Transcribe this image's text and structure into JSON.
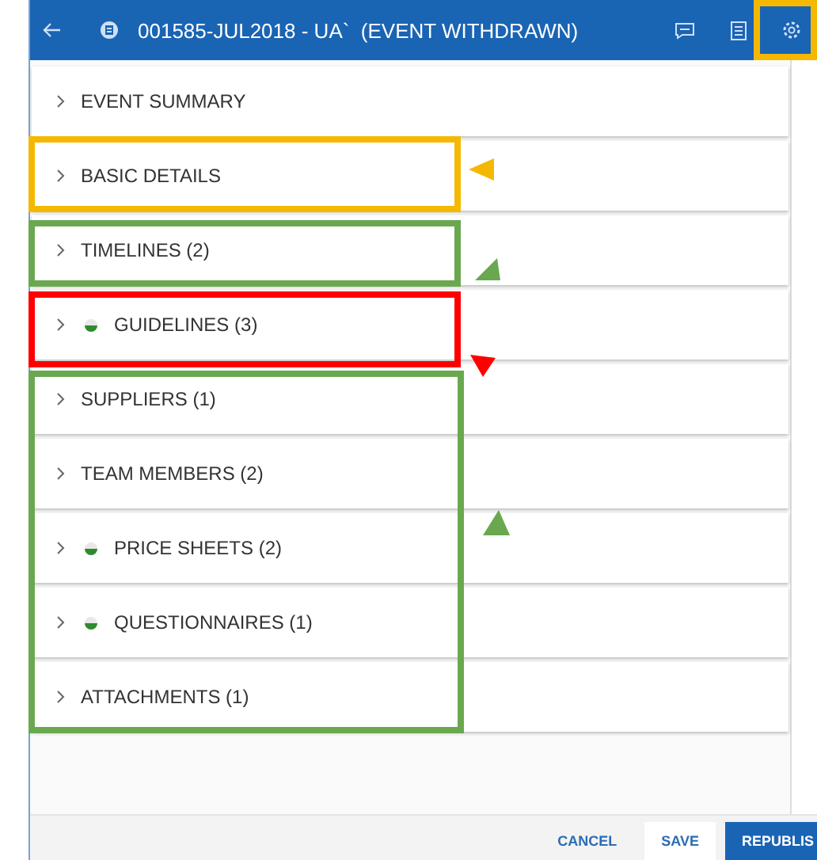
{
  "header": {
    "title": "001585-JUL2018 - UA`  (EVENT WITHDRAWN)"
  },
  "sections": [
    {
      "label": "EVENT SUMMARY",
      "has_status": false
    },
    {
      "label": "BASIC DETAILS",
      "has_status": false
    },
    {
      "label": "TIMELINES (2)",
      "has_status": false
    },
    {
      "label": "GUIDELINES (3)",
      "has_status": true
    },
    {
      "label": "SUPPLIERS (1)",
      "has_status": false
    },
    {
      "label": "TEAM MEMBERS (2)",
      "has_status": false
    },
    {
      "label": "PRICE SHEETS (2)",
      "has_status": true
    },
    {
      "label": "QUESTIONNAIRES (1)",
      "has_status": true
    },
    {
      "label": "ATTACHMENTS (1)",
      "has_status": false
    }
  ],
  "footer": {
    "buttons": [
      {
        "label": "CANCEL",
        "kind": "text"
      },
      {
        "label": "SAVE",
        "kind": "outline"
      },
      {
        "label": "REPUBLIS",
        "kind": "primary"
      }
    ]
  },
  "annotations": [
    {
      "kind": "box",
      "color": "#f5b800"
    },
    {
      "kind": "box",
      "color": "#f5b800"
    },
    {
      "kind": "box",
      "color": "#6aa84f"
    },
    {
      "kind": "box",
      "color": "#ff0000"
    },
    {
      "kind": "box",
      "color": "#6aa84f"
    },
    {
      "kind": "pointer",
      "color": "#f5b800"
    },
    {
      "kind": "pointer",
      "color": "#6aa84f"
    },
    {
      "kind": "pointer",
      "color": "#ff0000"
    },
    {
      "kind": "pointer",
      "color": "#6aa84f"
    }
  ]
}
